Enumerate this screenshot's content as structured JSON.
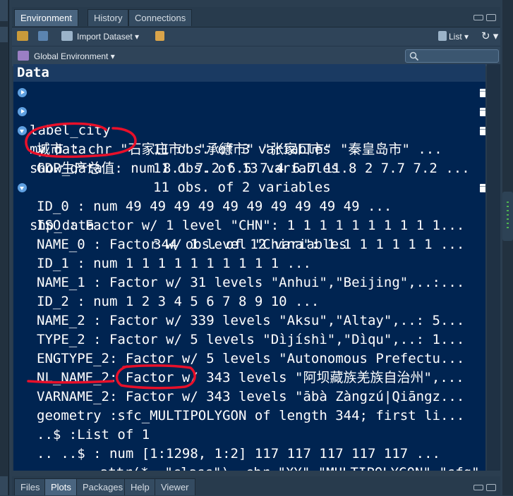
{
  "tabs": [
    "Environment",
    "History",
    "Connections"
  ],
  "toolbar": {
    "import_label": "Import Dataset",
    "view_label": "List"
  },
  "env_selector": "Global Environment",
  "section_header": "Data",
  "objects": [
    {
      "name": "label_city",
      "value": "11 obs. of 3 variables",
      "expanded": false
    },
    {
      "name": "my_data",
      "value": "11 obs. of 13 variables",
      "expanded": false
    },
    {
      "name": "show_data",
      "value": "11 obs. of 2 variables",
      "expanded": true,
      "children": [
        "城市 : chr \"石家庄市\" \"承德市\" \"张家口市\" \"秦皇岛市\" ...",
        "GDP生产总值: num 8.1 7.2 6.5 7.4 6.7 11.8 2 7.7 7.2 ..."
      ]
    },
    {
      "name": "shp_data",
      "value": "344 obs. of 12 variables",
      "expanded": true,
      "children": [
        "ID_0 : num 49 49 49 49 49 49 49 49 49 49 ...",
        "ISO : Factor w/ 1 level \"CHN\": 1 1 1 1 1 1 1 1 1 1...",
        "NAME_0 : Factor w/ 1 level \"China\": 1 1 1 1 1 1 1 ...",
        "ID_1 : num 1 1 1 1 1 1 1 1 1 1 ...",
        "NAME_1 : Factor w/ 31 levels \"Anhui\",\"Beijing\",..:...",
        "ID_2 : num 1 2 3 4 5 6 7 8 9 10 ...",
        "NAME_2 : Factor w/ 339 levels \"Aksu\",\"Altay\",..: 5...",
        "TYPE_2 : Factor w/ 5 levels \"Dìjíshì\",\"Dìqu\",..: 1...",
        "ENGTYPE_2: Factor w/ 5 levels \"Autonomous Prefectu...",
        "NL_NAME_2: Factor w/ 343 levels \"阿坝藏族羌族自治州\",...",
        "VARNAME_2: Factor w/ 343 levels \"ābà Zàngzú|Qiāngz...",
        "geometry :sfc_MULTIPOLYGON of length 344; first li...",
        "..$ :List of 1",
        ".. ..$ : num [1:1298, 1:2] 117 117 117 117 117 ...",
        "- attr(*, \"class\")= chr \"XY\" \"MULTIPOLYGON\" \"sfg\""
      ]
    }
  ],
  "bottom_tabs": [
    "Files",
    "Plots",
    "Packages",
    "Help",
    "Viewer"
  ],
  "colors": {
    "background": "#002451",
    "annotation": "#e8102a",
    "pane": "#283b4d"
  }
}
